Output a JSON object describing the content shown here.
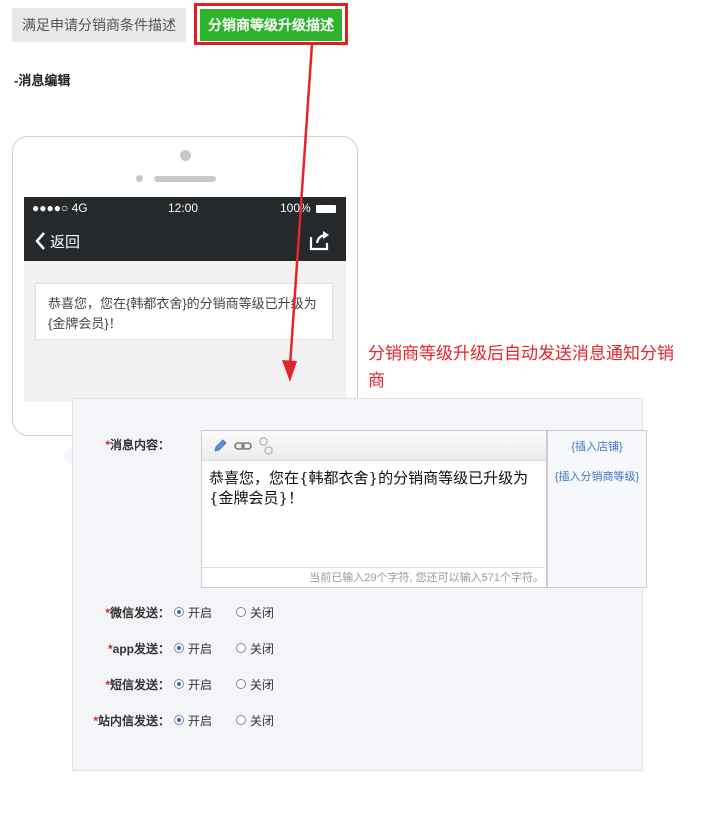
{
  "tabs": {
    "inactive_label": "满足申请分销商条件描述",
    "active_label": "分销商等级升级描述"
  },
  "section_title": "-消息编辑",
  "phone": {
    "signal": "●●●●○ 4G",
    "time": "12:00",
    "battery": "100%",
    "back_label": "返回",
    "message": "恭喜您，您在{韩都衣舍}的分销商等级已升级为{金牌会员}！"
  },
  "annotation": "分销商等级升级后自动发送消息通知分销商",
  "form": {
    "content_label": "消息内容：",
    "content_value": "恭喜您，您在{韩都衣舍}的分销商等级已升级为{金牌会员}！",
    "counter": "当前已输入29个字符, 您还可以输入571个字符。",
    "toolbar_icons": [
      "pencil-icon",
      "link-icon",
      "unlink-icon"
    ],
    "side_links": [
      "{插入店铺}",
      "{插入分销商等级}"
    ],
    "rows": [
      {
        "label": "微信发送：",
        "on": "开启",
        "off": "关闭",
        "selected": "on"
      },
      {
        "label": "app发送：",
        "on": "开启",
        "off": "关闭",
        "selected": "on"
      },
      {
        "label": "短信发送：",
        "on": "开启",
        "off": "关闭",
        "selected": "on"
      },
      {
        "label": "站内信发送：",
        "on": "开启",
        "off": "关闭",
        "selected": "on"
      }
    ]
  },
  "colors": {
    "active_tab": "#2fb32f",
    "highlight": "#e02020",
    "annotation": "#e3242b",
    "link": "#3a78c4"
  }
}
